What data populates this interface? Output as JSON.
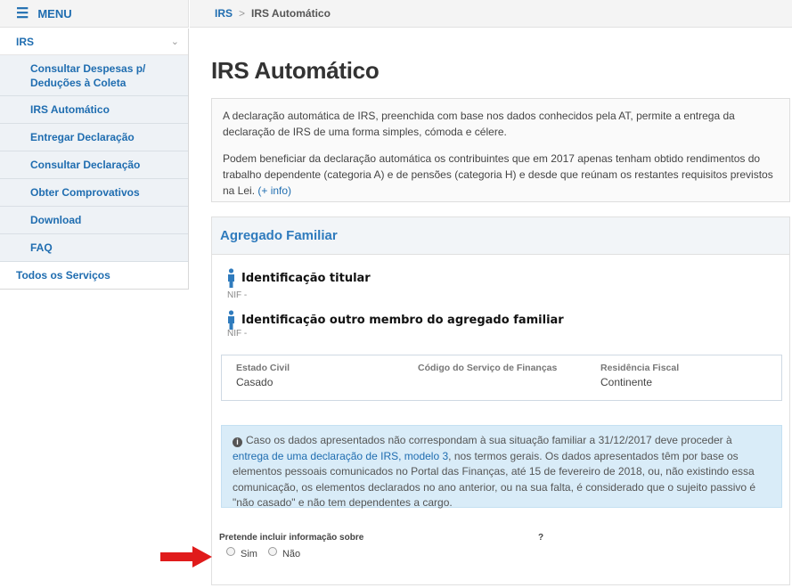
{
  "menu": {
    "title": "MENU",
    "icon": "hamburger-icon"
  },
  "sidebar": {
    "group": {
      "label": "IRS",
      "icon": "chevron-down-icon"
    },
    "items": [
      {
        "label": "Consultar Despesas p/ Deduções à Coleta"
      },
      {
        "label": "IRS Automático"
      },
      {
        "label": "Entregar Declaração"
      },
      {
        "label": "Consultar Declaração"
      },
      {
        "label": "Obter Comprovativos"
      },
      {
        "label": "Download"
      },
      {
        "label": "FAQ"
      }
    ],
    "footer": "Todos os Serviços"
  },
  "breadcrumb": {
    "root": "IRS",
    "separator": ">",
    "current": "IRS Automático"
  },
  "page": {
    "title": "IRS Automático",
    "intro_p1": "A declaração automática de IRS, preenchida com base nos dados conhecidos pela AT, permite a entrega da declaração de IRS de uma forma simples, cómoda e célere.",
    "intro_p2": "Podem beneficiar da declaração automática os contribuintes que em 2017 apenas tenham obtido rendimentos do trabalho dependente (categoria A) e de pensões (categoria H) e desde que reúnam os restantes requisitos previstos na Lei.",
    "intro_link": "(+ info)"
  },
  "family": {
    "heading": "Agregado Familiar",
    "titular": {
      "title": "Identificação titular",
      "nif": "NIF -"
    },
    "other": {
      "title": "Identificação outro membro do agregado familiar",
      "nif": "NIF -"
    },
    "details": {
      "estado_civil_label": "Estado Civil",
      "estado_civil_value": "Casado",
      "codigo_label": "Código do Serviço de Finanças",
      "codigo_value": "",
      "residencia_label": "Residência Fiscal",
      "residencia_value": "Continente"
    },
    "alert": {
      "text_before": "Caso os dados apresentados não correspondam à sua situação familiar a 31/12/2017 deve proceder à ",
      "link": "entrega de uma declaração de IRS, modelo 3",
      "text_after": ", nos termos gerais. Os dados apresentados têm por base os elementos pessoais comunicados no Portal das Finanças, até 15 de fevereiro de 2018, ou, não existindo essa comunicação, os elementos declarados no ano anterior, ou na sua falta, é considerado que o sujeito passivo é \"não casado\" e não tem dependentes a cargo."
    },
    "question": "Pretende incluir informação sobre",
    "question_mark": "?",
    "options": [
      {
        "label": "Sim"
      },
      {
        "label": "Não"
      }
    ]
  },
  "colors": {
    "brand_blue": "#1f6db0",
    "heading_blue": "#2f7bbd",
    "alert_bg": "#d9ecf8",
    "arrow_red": "#e01b1b"
  }
}
